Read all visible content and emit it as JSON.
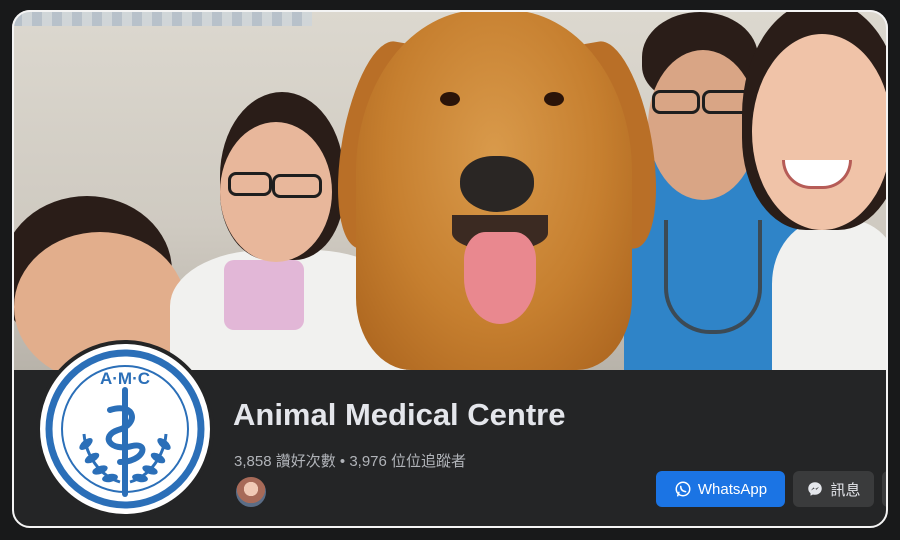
{
  "page": {
    "title": "Animal Medical Centre",
    "likes_text": "3,858 讚好次數",
    "separator": "•",
    "followers_text": "3,976 位位追蹤者"
  },
  "logo": {
    "text": "A·M·C",
    "color": "#2b6fb8"
  },
  "actions": {
    "whatsapp_label": "WhatsApp",
    "message_label": "訊息"
  },
  "icons": {
    "whatsapp": "whatsapp-icon",
    "messenger": "messenger-icon",
    "more": "more-icon"
  },
  "colors": {
    "primary_button": "#1b74e4",
    "secondary_button": "#3a3b3c",
    "background": "#242526",
    "title_text": "#e4e6eb",
    "muted_text": "#b0b3b8"
  }
}
